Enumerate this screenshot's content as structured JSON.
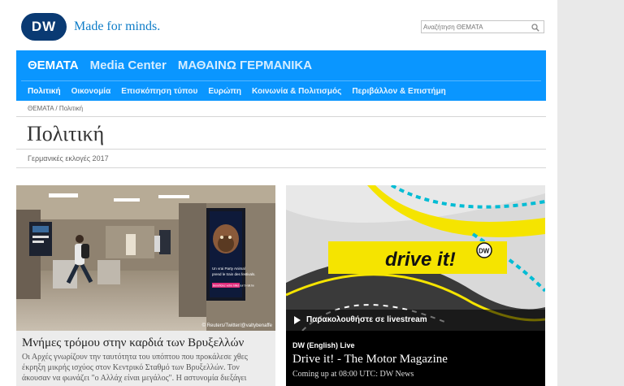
{
  "header": {
    "logo_text": "DW",
    "slogan": "Made for minds.",
    "search_placeholder": "Αναζήτηση ΘΕΜΑΤΑ"
  },
  "nav": {
    "primary": [
      "ΘΕΜΑΤΑ",
      "Media Center",
      "ΜΑΘΑΙΝΩ ΓΕΡΜΑΝΙΚΑ"
    ],
    "secondary": [
      "Πολιτική",
      "Οικονομία",
      "Επισκόπηση τύπου",
      "Ευρώπη",
      "Κοινωνία & Πολιτισμός",
      "Περιβάλλον & Επιστήμη"
    ]
  },
  "breadcrumb": "ΘΕΜΑΤΑ / Πολιτική",
  "page_title": "Πολιτική",
  "tag": "Γερμανικές εκλογές 2017",
  "article": {
    "credit": "© Reuters/Twitter/@valtybenaffe",
    "headline": "Μνήμες τρόμου στην καρδιά των Βρυξελλών",
    "summary": "Οι Αρχές γνωρίζουν την ταυτότητα του υπόπτου που προκάλεσε χθες έκρηξη μικρής ισχύος στον Κεντρικό Σταθμό των Βρυξελλών. Τον άκουσαν να φωνάζει \"ο Αλλάχ είναι μεγάλος\". Η αστυνομία διεξάγει",
    "poster_lines": [
      "Un vrai Party Animal",
      "prend le train des festivals.",
      "Bénéficiez votre billet sur b-rail.be"
    ]
  },
  "live": {
    "banner_text": "drive it!",
    "badge": "DW",
    "watch_label": "Παρακολουθήστε σε livestream",
    "channel": "DW (English) Live",
    "program": "Drive it! - The Motor Magazine",
    "next": "Coming up at 08:00 UTC: DW News"
  },
  "colors": {
    "nav_blue": "#0a96ff",
    "dw_navy": "#0a3a73",
    "slogan_blue": "#0f7dc8",
    "drive_yellow": "#f5e400"
  }
}
